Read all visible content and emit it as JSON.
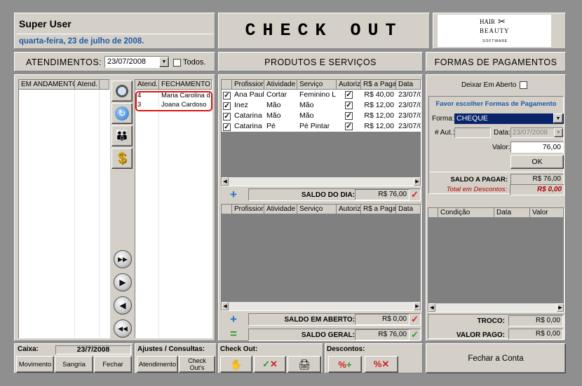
{
  "user": {
    "name": "Super User",
    "date": "quarta-feira, 23 de julho de 2008."
  },
  "title": "CHECK OUT",
  "logo": {
    "line1": "HAIR",
    "line2": "BEAUTY",
    "line3": "SOFTWARE"
  },
  "atendimentos": {
    "label": "ATENDIMENTOS:",
    "date": "23/07/2008",
    "todos_label": "Todos."
  },
  "left_grid": {
    "headers": [
      "EM ANDAMENTO",
      "Atend."
    ]
  },
  "fechamento_grid": {
    "headers": [
      "Atend.",
      "FECHAMENTO"
    ],
    "rows": [
      {
        "atend": "4",
        "nome": "Maria Carolina d..."
      },
      {
        "atend": "3",
        "nome": "Joana Cardoso"
      }
    ]
  },
  "produtos": {
    "title": "PRODUTOS E SERVIÇOS",
    "headers": [
      "Profission",
      "Atividade",
      "Serviço",
      "Autoriz",
      "R$ a Paga",
      "Data"
    ],
    "rows": [
      {
        "prof": "Ana Paul",
        "atividade": "Cortar",
        "servico": "Feminino L",
        "valor": "R$ 40,00",
        "data": "23/07/08"
      },
      {
        "prof": "Inez",
        "atividade": "Mão",
        "servico": "Mão",
        "valor": "R$ 12,00",
        "data": "23/07/08"
      },
      {
        "prof": "Catarina",
        "atividade": "Mão",
        "servico": "Mão",
        "valor": "R$ 12,00",
        "data": "23/07/08"
      },
      {
        "prof": "Catarina",
        "atividade": "Pé",
        "servico": "Pé Pintar",
        "valor": "R$ 12,00",
        "data": "23/07/08"
      }
    ],
    "saldo_dia_label": "SALDO DO DIA:",
    "saldo_dia_value": "R$ 76,00",
    "headers2": [
      "Profission",
      "Atividade",
      "Serviço",
      "Autoriz",
      "R$ a Paga",
      "Data"
    ],
    "saldo_aberto_label": "SALDO EM ABERTO:",
    "saldo_aberto_value": "R$ 0,00",
    "saldo_geral_label": "SALDO GERAL:",
    "saldo_geral_value": "R$ 76,00",
    "plus": "+",
    "equals": "="
  },
  "pagamentos": {
    "title": "FORMAS DE PAGAMENTOS",
    "deixar_label": "Deixar Em Aberto",
    "favor_label": "Favor escolher Formas de Pagamento",
    "forma_label": "Forma:",
    "forma_value": "CHEQUE",
    "aut_label": "# Aut.:",
    "data_label": "Data:",
    "data_value": "23/07/2008",
    "valor_label": "Valor:",
    "valor_value": "76,00",
    "ok_label": "OK",
    "saldo_pagar_label": "SALDO A PAGAR:",
    "saldo_pagar_value": "R$ 76,00",
    "total_desc_label": "Total em Descontos:",
    "total_desc_value": "R$ 0,00",
    "cond_headers": [
      "Condição",
      "Data",
      "Valor"
    ],
    "troco_label": "TROCO:",
    "troco_value": "R$ 0,00",
    "valor_pago_label": "VALOR PAGO:",
    "valor_pago_value": "R$ 0,00",
    "fechar_conta": "Fechar a Conta"
  },
  "bottom": {
    "caixa_label": "Caixa:",
    "caixa_date": "23/7/2008",
    "movimento": "Movimento",
    "sangria": "Sangria",
    "fechar": "Fechar",
    "ajustes_label": "Ajustes / Consultas:",
    "atendimento": "Atendimento",
    "checkouts": "Check Out's",
    "checkout_label": "Check Out:",
    "descontos_label": "Descontos:"
  },
  "colors": {
    "accent_blue": "#1e5aa8",
    "selection_navy": "#0a246a",
    "red_text": "#b00000"
  }
}
